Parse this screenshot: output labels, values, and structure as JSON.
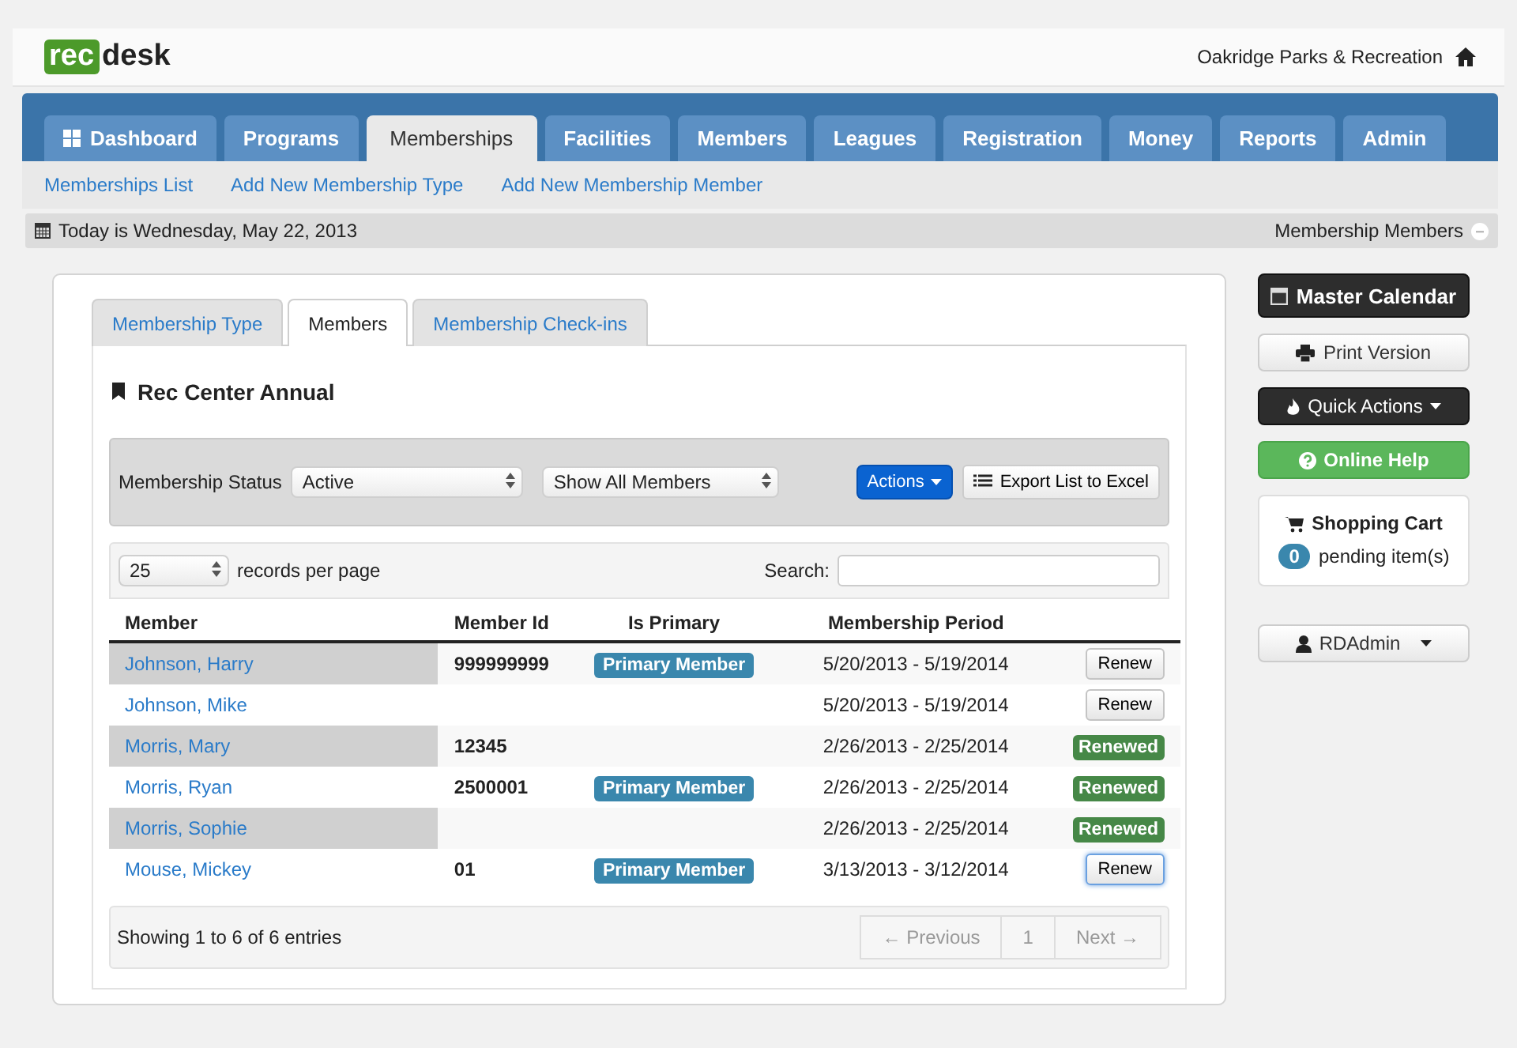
{
  "header": {
    "logo": [
      "rec",
      "desk"
    ],
    "organization": "Oakridge Parks & Recreation"
  },
  "nav": {
    "tabs": [
      {
        "label": "Dashboard",
        "selected": false,
        "icon": true
      },
      {
        "label": "Programs",
        "selected": false
      },
      {
        "label": "Memberships",
        "selected": true
      },
      {
        "label": "Facilities",
        "selected": false
      },
      {
        "label": "Members",
        "selected": false
      },
      {
        "label": "Leagues",
        "selected": false
      },
      {
        "label": "Registration",
        "selected": false
      },
      {
        "label": "Money",
        "selected": false
      },
      {
        "label": "Reports",
        "selected": false
      },
      {
        "label": "Admin",
        "selected": false
      }
    ],
    "sub_links": [
      "Memberships List",
      "Add New Membership Type",
      "Add New Membership Member"
    ]
  },
  "info_bar": {
    "date": "Today is Wednesday, May 22, 2013",
    "page": "Membership Members"
  },
  "content": {
    "tabs": [
      {
        "label": "Membership Type",
        "selected": false
      },
      {
        "label": "Members",
        "selected": true
      },
      {
        "label": "Membership Check-ins",
        "selected": false
      }
    ],
    "title": "Rec Center Annual",
    "filters": {
      "status_label": "Membership Status",
      "status": "Active",
      "show": "Show All Members",
      "actions": "Actions",
      "export": "Export List to Excel"
    },
    "page_size": "25",
    "page_size_label": "records per page",
    "search_label": "Search:",
    "table": {
      "columns": [
        "Member",
        "Member Id",
        "Is Primary",
        "Membership Period"
      ],
      "rows": [
        {
          "member": "Johnson, Harry",
          "member_id": "999999999",
          "primary": "Primary Member",
          "period": "5/20/2013 -  5/19/2014",
          "action": {
            "kind": "button",
            "label": "Renew",
            "focused": false
          }
        },
        {
          "member": "Johnson, Mike",
          "period": "5/20/2013 -  5/19/2014",
          "action": {
            "kind": "button",
            "label": "Renew",
            "focused": false
          }
        },
        {
          "member": "Morris, Mary",
          "member_id": "12345",
          "period": "2/26/2013 -  2/25/2014",
          "action": {
            "kind": "badge",
            "label": "Renewed"
          }
        },
        {
          "member": "Morris, Ryan",
          "member_id": "2500001",
          "primary": "Primary Member",
          "period": "2/26/2013 -  2/25/2014",
          "action": {
            "kind": "badge",
            "label": "Renewed"
          }
        },
        {
          "member": "Morris, Sophie",
          "period": "2/26/2013 -  2/25/2014",
          "action": {
            "kind": "badge",
            "label": "Renewed"
          }
        },
        {
          "member": "Mouse, Mickey",
          "member_id": "01",
          "primary": "Primary Member",
          "period": "3/13/2013 -  3/12/2014",
          "action": {
            "kind": "button",
            "label": "Renew",
            "focused": true
          }
        }
      ]
    },
    "footer": {
      "info": "Showing 1 to 6 of 6 entries",
      "pagination": [
        {
          "label": "← Previous",
          "disabled": true
        },
        {
          "label": "1",
          "disabled": true
        },
        {
          "label": "Next →",
          "disabled": true
        }
      ]
    }
  },
  "sidebar": {
    "master_calendar": "Master Calendar",
    "print": "Print Version",
    "quick_actions": "Quick Actions",
    "help": "Online Help",
    "cart": {
      "title": "Shopping Cart",
      "count": "0",
      "label": "pending item(s)"
    },
    "user": "RDAdmin"
  }
}
